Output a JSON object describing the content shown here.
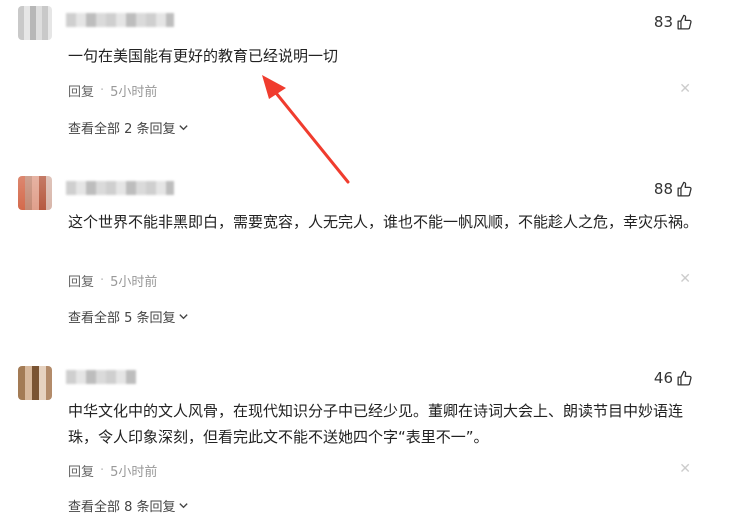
{
  "comments": [
    {
      "likes": "83",
      "text": "一句在美国能有更好的教育已经说明一切",
      "reply_label": "回复",
      "time": "5小时前",
      "view_all": "查看全部 2 条回复"
    },
    {
      "likes": "88",
      "text": "这个世界不能非黑即白，需要宽容，人无完人，谁也不能一帆风顺，不能趁人之危，幸灾乐祸。",
      "reply_label": "回复",
      "time": "5小时前",
      "view_all": "查看全部 5 条回复"
    },
    {
      "likes": "46",
      "text": "中华文化中的文人风骨，在现代知识分子中已经少见。董卿在诗词大会上、朗读节目中妙语连珠，令人印象深刻，但看完此文不能不送她四个字“表里不一”。",
      "reply_label": "回复",
      "time": "5小时前",
      "view_all": "查看全部 8 条回复"
    }
  ],
  "icons": {
    "like": "thumbs-up-icon",
    "close": "close-icon",
    "chevron": "chevron-down-icon",
    "annotation": "red-arrow-annotation"
  },
  "colors": {
    "annotation_arrow": "#f03c2e",
    "meta_text": "#999999"
  }
}
